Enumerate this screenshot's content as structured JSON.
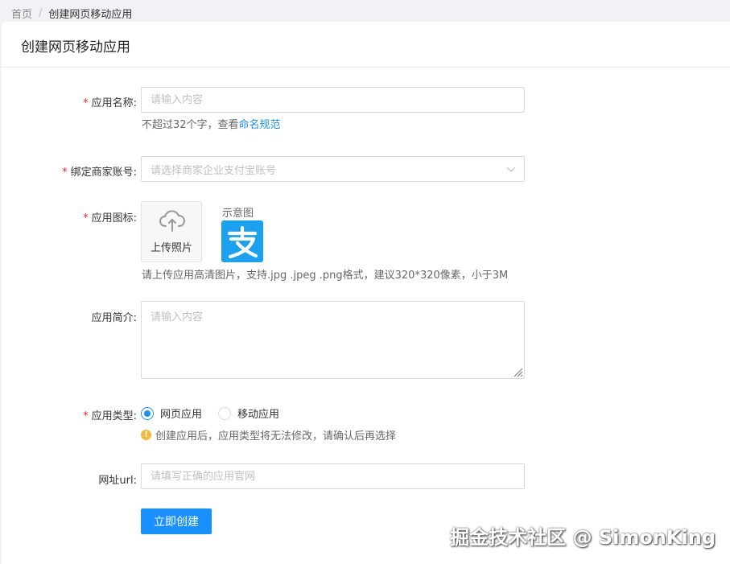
{
  "breadcrumb": {
    "home": "首页",
    "separator": "/",
    "current": "创建网页移动应用"
  },
  "page": {
    "title": "创建网页移动应用"
  },
  "form": {
    "required_mark": "*",
    "app_name": {
      "label": "应用名称:",
      "placeholder": "请输入内容",
      "help_text": "不超过32个字，查看",
      "help_link": "命名规范"
    },
    "merchant_account": {
      "label": "绑定商家账号:",
      "placeholder": "请选择商家企业支付宝账号"
    },
    "app_icon": {
      "label": "应用图标:",
      "upload_label": "上传照片",
      "sample_label": "示意图",
      "sample_glyph": "支",
      "help_text": "请上传应用高清图片，支持.jpg .jpeg .png格式，建议320*320像素，小于3M"
    },
    "app_intro": {
      "label": "应用简介:",
      "placeholder": "请输入内容"
    },
    "app_type": {
      "label": "应用类型:",
      "options": [
        "网页应用",
        "移动应用"
      ],
      "selected": "网页应用",
      "warning": "创建应用后，应用类型将无法修改，请确认后再选择"
    },
    "url": {
      "label": "网址url:",
      "placeholder": "请填写正确的应用官网"
    },
    "submit_label": "立即创建"
  },
  "watermark": "掘金技术社区 @ SimonKing",
  "colors": {
    "primary": "#1890ff",
    "required": "#f5222d",
    "warning": "#f5b93b",
    "sample_bg": "#1aa1f0"
  },
  "icons": [
    "chevron-down-icon",
    "cloud-upload-icon",
    "resize-grip-icon",
    "warning-icon"
  ]
}
